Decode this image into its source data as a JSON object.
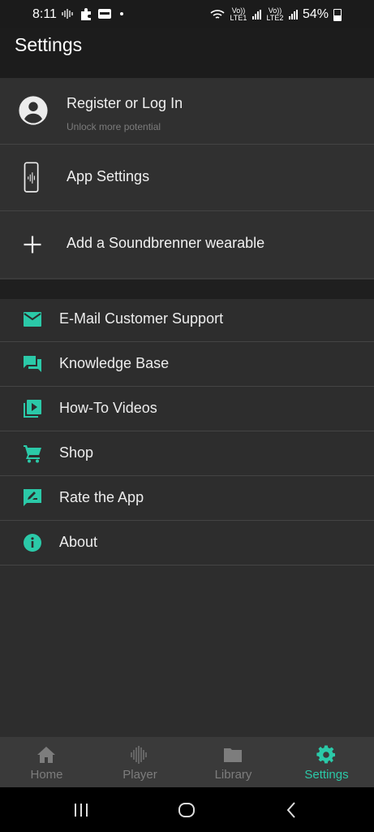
{
  "status": {
    "time": "8:11",
    "battery": "54%",
    "sim1": "Vo)) LTE1",
    "sim2": "Vo)) LTE2"
  },
  "appbar": {
    "title": "Settings"
  },
  "account": {
    "title": "Register or Log In",
    "subtitle": "Unlock more potential",
    "icon": "account-circle-icon"
  },
  "app_settings": {
    "label": "App Settings",
    "icon": "phone-icon"
  },
  "add_wearable": {
    "label": "Add a Soundbrenner wearable",
    "icon": "plus-icon"
  },
  "support": [
    {
      "label": "E-Mail Customer Support",
      "icon": "mail-icon"
    },
    {
      "label": "Knowledge Base",
      "icon": "chat-icon"
    },
    {
      "label": "How-To Videos",
      "icon": "video-library-icon"
    },
    {
      "label": "Shop",
      "icon": "cart-icon"
    },
    {
      "label": "Rate the App",
      "icon": "rate-review-icon"
    },
    {
      "label": "About",
      "icon": "info-icon"
    }
  ],
  "nav": [
    {
      "label": "Home",
      "icon": "home-icon"
    },
    {
      "label": "Player",
      "icon": "waveform-icon"
    },
    {
      "label": "Library",
      "icon": "folder-icon"
    },
    {
      "label": "Settings",
      "icon": "gear-icon",
      "active": true
    }
  ],
  "colors": {
    "accent": "#2bc9a8",
    "background": "#2d2d2d",
    "appbar": "#1c1c1c",
    "bottom_nav": "#3a3a3a"
  }
}
